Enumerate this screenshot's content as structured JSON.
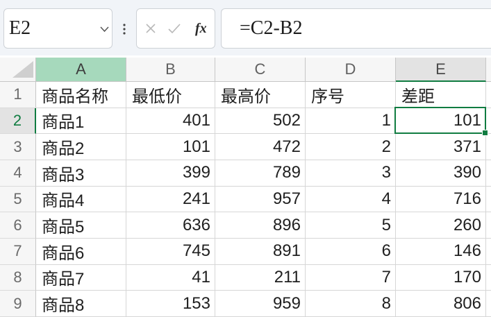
{
  "name_box": {
    "value": "E2",
    "dropdown_icon": "chevron-down-icon"
  },
  "formula_bar": {
    "more_icon": "more-vertical-icon",
    "cancel_icon": "close-icon",
    "enter_icon": "check-icon",
    "function_label": "fx",
    "formula": "=C2-B2"
  },
  "sheet": {
    "columns": [
      "A",
      "B",
      "C",
      "D",
      "E"
    ],
    "rows": [
      {
        "number": 1,
        "cells": [
          "商品名称",
          "最低价",
          "最高价",
          "序号",
          "差距"
        ]
      },
      {
        "number": 2,
        "cells": [
          "商品1",
          401,
          502,
          1,
          101
        ]
      },
      {
        "number": 3,
        "cells": [
          "商品2",
          101,
          472,
          2,
          371
        ]
      },
      {
        "number": 4,
        "cells": [
          "商品3",
          399,
          789,
          3,
          390
        ]
      },
      {
        "number": 5,
        "cells": [
          "商品4",
          241,
          957,
          4,
          716
        ]
      },
      {
        "number": 6,
        "cells": [
          "商品5",
          636,
          896,
          5,
          260
        ]
      },
      {
        "number": 7,
        "cells": [
          "商品6",
          745,
          891,
          6,
          146
        ]
      },
      {
        "number": 8,
        "cells": [
          "商品7",
          41,
          211,
          7,
          170
        ]
      },
      {
        "number": 9,
        "cells": [
          "商品8",
          153,
          959,
          8,
          806
        ]
      }
    ]
  },
  "colors": {
    "accent": "#107c41",
    "column_a_header_fill": "#a6d9bc",
    "gridline": "#d6d6d6"
  }
}
